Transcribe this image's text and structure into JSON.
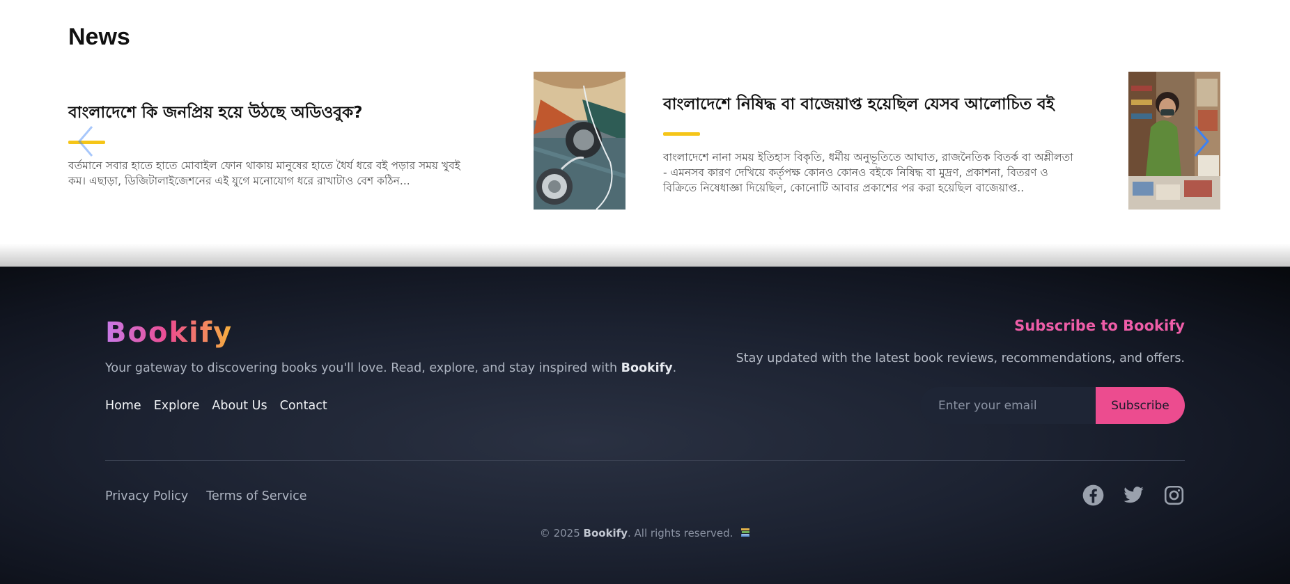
{
  "news": {
    "title": "News",
    "items": [
      {
        "headline": "বাংলাদেশে কি জনপ্রিয় হয়ে উঠছে অডিওবুক?",
        "excerpt_line1": "বর্তমানে সবার হাতে হাতে মোবাইল ফোন থাকায় মানুষের হাতে ধৈর্য ধরে বই পড়ার সময় খুবই",
        "excerpt_line2": "কম। এছাড়া, ডিজিটালাইজেশনের এই যুগে মনোযোগ ধরে রাখাটাও বেশ কঠিন..."
      },
      {
        "headline": "বাংলাদেশে নিষিদ্ধ বা বাজেয়াপ্ত হয়েছিল যেসব আলোচিত বই",
        "excerpt_line1": "বাংলাদেশে নানা সময় ইতিহাস বিকৃতি, ধর্মীয় অনুভূতিতে আঘাত, রাজনৈতিক বিতর্ক বা অশ্লীলতা",
        "excerpt_line2": "- এমনসব কারণ দেখিয়ে কর্তৃপক্ষ কোনও কোনও বইকে নিষিদ্ধ বা মুদ্রণ, প্রকাশনা, বিতরণ ও",
        "excerpt_line3": "বিক্রিতে নিষেধাজ্ঞা দিয়েছিল, কোনোটি আবার প্রকাশের পর করা হয়েছিল বাজেয়াপ্ত.."
      }
    ],
    "accent_color": "#f5c518",
    "arrow_color": "#3b82f6"
  },
  "footer": {
    "brand": "Bookify",
    "tagline_prefix": "Your gateway to discovering books you'll love. Read, explore, and stay inspired with ",
    "tagline_brand": "Bookify",
    "tagline_suffix": ".",
    "nav": [
      "Home",
      "Explore",
      "About Us",
      "Contact"
    ],
    "subscribe": {
      "title": "Subscribe to Bookify",
      "text": "Stay updated with the latest book reviews, recommendations, and offers.",
      "placeholder": "Enter your email",
      "button": "Subscribe"
    },
    "legal": [
      "Privacy Policy",
      "Terms of Service"
    ],
    "social_icons": [
      "facebook-icon",
      "twitter-icon",
      "instagram-icon"
    ],
    "copyright_prefix": "© 2025 ",
    "copyright_brand": "Bookify",
    "copyright_suffix": ". All rights reserved.",
    "accent_color": "#ec4c8f"
  }
}
